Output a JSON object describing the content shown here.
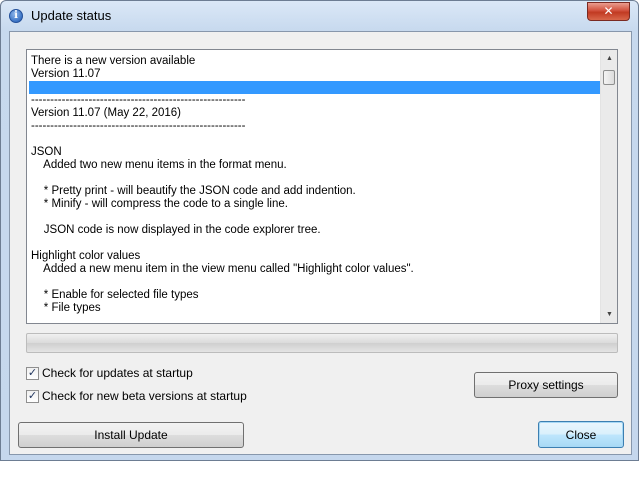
{
  "window": {
    "title": "Update status",
    "close_glyph": "✕",
    "icon": "info-icon"
  },
  "changelog": {
    "lines": [
      {
        "text": "There is a new version available",
        "selected": false
      },
      {
        "text": "Version 11.07",
        "selected": false
      },
      {
        "text": "",
        "selected": true
      },
      {
        "text": "--------------------------------------------------------",
        "selected": false
      },
      {
        "text": "Version 11.07 (May 22, 2016)",
        "selected": false
      },
      {
        "text": "--------------------------------------------------------",
        "selected": false
      },
      {
        "text": "",
        "selected": false
      },
      {
        "text": "JSON",
        "selected": false
      },
      {
        "text": "    Added two new menu items in the format menu.",
        "selected": false
      },
      {
        "text": "",
        "selected": false
      },
      {
        "text": "    * Pretty print - will beautify the JSON code and add indention.",
        "selected": false
      },
      {
        "text": "    * Minify - will compress the code to a single line.",
        "selected": false
      },
      {
        "text": "",
        "selected": false
      },
      {
        "text": "    JSON code is now displayed in the code explorer tree.",
        "selected": false
      },
      {
        "text": "",
        "selected": false
      },
      {
        "text": "Highlight color values",
        "selected": false
      },
      {
        "text": "    Added a new menu item in the view menu called \"Highlight color values\".",
        "selected": false
      },
      {
        "text": "",
        "selected": false
      },
      {
        "text": "    * Enable for selected file types",
        "selected": false
      },
      {
        "text": "    * File types",
        "selected": false
      }
    ]
  },
  "progress": {
    "value": 0
  },
  "options": {
    "check_updates_label": "Check for updates at startup",
    "check_updates_checked": true,
    "check_beta_label": "Check for new beta versions at startup",
    "check_beta_checked": true
  },
  "buttons": {
    "proxy_label": "Proxy settings",
    "install_label": "Install Update",
    "close_label": "Close"
  },
  "icons": {
    "check_glyph": "✓",
    "scroll_up_glyph": "▲",
    "scroll_down_glyph": "▼",
    "info_glyph": "i"
  }
}
